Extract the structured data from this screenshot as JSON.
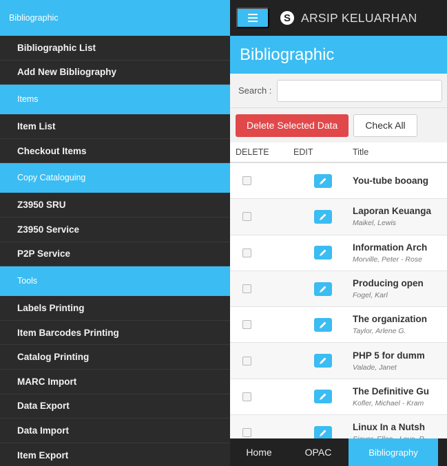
{
  "sidebar": {
    "sections": [
      {
        "header": "Bibliographic",
        "items": [
          "Bibliographic List",
          "Add New Bibliography"
        ]
      },
      {
        "header": "Items",
        "items": [
          "Item List",
          "Checkout Items"
        ]
      },
      {
        "header": "Copy Cataloguing",
        "items": [
          "Z3950 SRU",
          "Z3950 Service",
          "P2P Service"
        ]
      },
      {
        "header": "Tools",
        "items": [
          "Labels Printing",
          "Item Barcodes Printing",
          "Catalog Printing",
          "MARC Import",
          "Data Export",
          "Data Import",
          "Item Export"
        ]
      }
    ]
  },
  "topbar": {
    "app_title": "ARSIP KELUARHAN",
    "logo_glyph": "S",
    "logo_icon": "s-logo-icon",
    "menu_icon": "hamburger-icon"
  },
  "section": {
    "title": "Bibliographic"
  },
  "search": {
    "label": "Search :",
    "value": "",
    "placeholder": ""
  },
  "actions": {
    "delete_label": "Delete Selected Data",
    "check_all_label": "Check All"
  },
  "table": {
    "headers": {
      "delete": "DELETE",
      "edit": "EDIT",
      "title": "Title"
    },
    "rows": [
      {
        "title": "You-tube booang",
        "author": ""
      },
      {
        "title": "Laporan Keuanga",
        "author": "Maikel, Lewis"
      },
      {
        "title": "Information Arch",
        "author": "Morville, Peter - Rose"
      },
      {
        "title": "Producing open",
        "author": "Fogel, Karl"
      },
      {
        "title": "The organization",
        "author": "Taylor, Arlene G."
      },
      {
        "title": "PHP 5 for dumm",
        "author": "Valade, Janet"
      },
      {
        "title": "The Definitive Gu",
        "author": "Kofler, Michael - Kram"
      },
      {
        "title": "Linux In a Nutsh",
        "author": "Siever, Ellen - Love, R"
      }
    ]
  },
  "bottom_nav": {
    "items": [
      {
        "label": "Home",
        "active": false
      },
      {
        "label": "OPAC",
        "active": false
      },
      {
        "label": "Bibliography",
        "active": true
      }
    ]
  },
  "colors": {
    "accent": "#3bbcf2",
    "danger": "#e0484a",
    "sidebar_bg": "#2b2b2b",
    "topbar_bg": "#222222"
  }
}
